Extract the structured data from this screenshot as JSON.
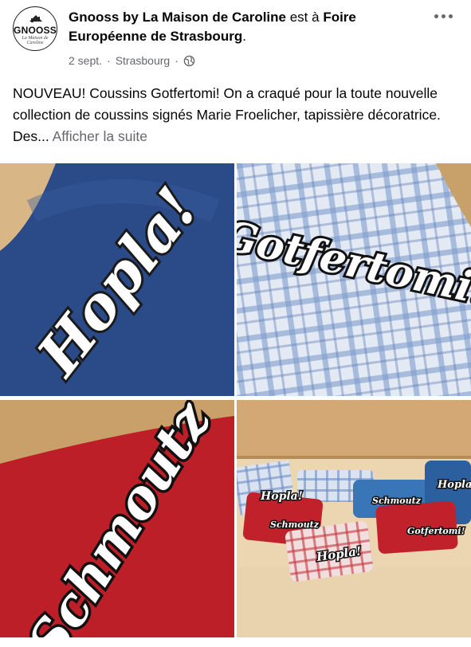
{
  "post": {
    "avatar_text": "GNOOSS",
    "avatar_sub": "La Maison de Caroline",
    "author": "Gnooss by La Maison de Caroline",
    "connector": " est à ",
    "place": "Foire Européenne de Strasbourg",
    "place_suffix": ".",
    "date": "2 sept.",
    "location": "Strasbourg",
    "sep": "·",
    "audience_icon": "globe-icon",
    "text": "NOUVEAU! Coussins Gotfertomi! On a craqué pour la toute nouvelle collection de coussins signés Marie Froelicher, tapissière décoratrice. Des...",
    "see_more": "Afficher la suite"
  },
  "photos": [
    {
      "label": "Hopla!"
    },
    {
      "label": "Gotfertomi!"
    },
    {
      "label": "Schmoutz"
    },
    {
      "labels": [
        "Hopla!",
        "Schmoutz",
        "Schmoutz",
        "Hopla!",
        "Hopla!",
        "Gotfertomi!"
      ]
    }
  ]
}
